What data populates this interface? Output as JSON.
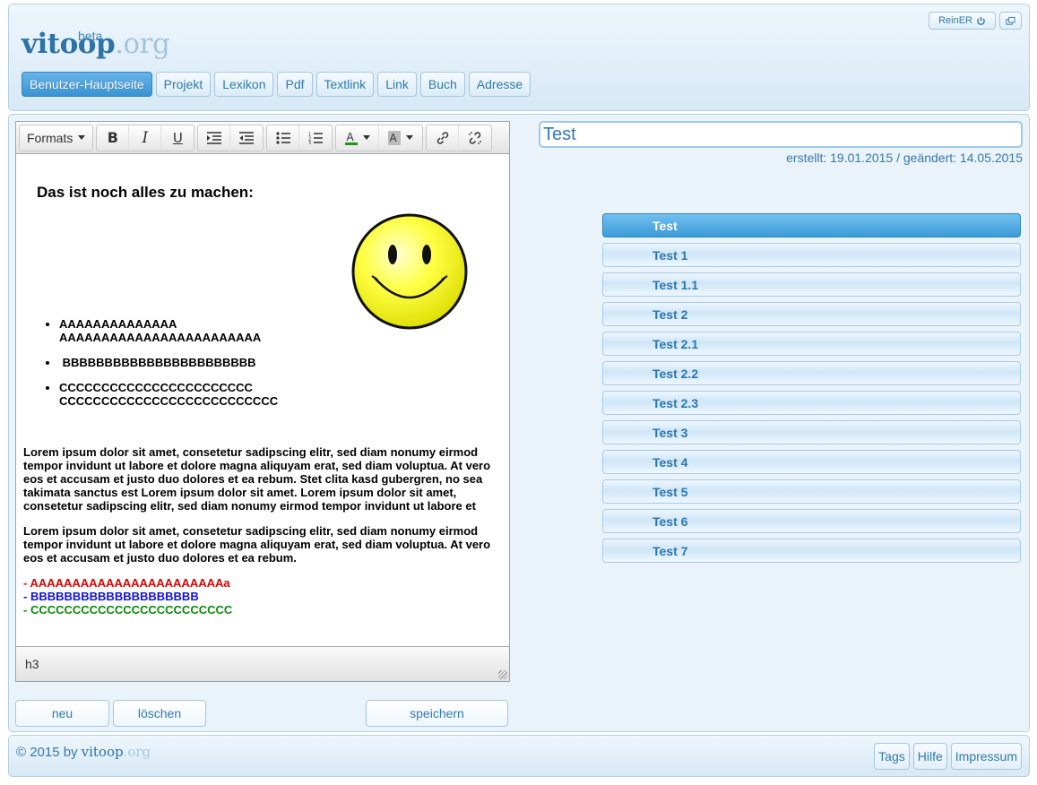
{
  "header": {
    "logo_main": "vitoop",
    "logo_dot": ".org",
    "beta": "beta",
    "user_button": "ReinER",
    "nav": [
      "Benutzer-Hauptseite",
      "Projekt",
      "Lexikon",
      "Pdf",
      "Textlink",
      "Link",
      "Buch",
      "Adresse"
    ]
  },
  "editor": {
    "formats_label": "Formats",
    "heading": "Das ist noch alles zu machen:",
    "bullets": [
      "AAAAAAAAAAAAAA AAAAAAAAAAAAAAAAAAAAAAAA",
      " BBBBBBBBBBBBBBBBBBBBBBB",
      "CCCCCCCCCCCCCCCCCCCCCCC CCCCCCCCCCCCCCCCCCCCCCCCCC"
    ],
    "para1": "Lorem ipsum dolor sit amet, consetetur sadipscing elitr, sed diam nonumy eirmod tempor invidunt ut labore et dolore magna aliquyam erat, sed diam voluptua. At vero eos et accusam et justo duo dolores et ea rebum. Stet clita kasd gubergren, no sea takimata sanctus est Lorem ipsum dolor sit amet. Lorem ipsum dolor sit amet, consetetur sadipscing elitr, sed diam nonumy eirmod tempor invidunt ut labore et",
    "para2": "Lorem ipsum dolor sit amet, consetetur sadipscing elitr, sed diam nonumy eirmod tempor invidunt ut labore et dolore magna aliquyam erat, sed diam voluptua. At vero eos et accusam et justo duo dolores et ea rebum.",
    "line_red": "- AAAAAAAAAAAAAAAAAAAAAAAa",
    "line_blue": "- BBBBBBBBBBBBBBBBBBBB",
    "line_green": "- CCCCCCCCCCCCCCCCCCCCCCCC",
    "status_path": "h3",
    "colors": {
      "red": "#e00000",
      "blue": "#1010e0",
      "green": "#0a8a0a"
    }
  },
  "actions": {
    "new": "neu",
    "delete": "löschen",
    "save": "speichern"
  },
  "right": {
    "title_value": "Test",
    "meta": "erstellt: 19.01.2015 / geändert: 14.05.2015",
    "tree": [
      "Test",
      "Test 1",
      "Test 1.1",
      "Test 2",
      "Test 2.1",
      "Test 2.2",
      "Test 2.3",
      "Test 3",
      "Test 4",
      "Test 5",
      "Test 6",
      "Test 7"
    ],
    "active_index": 0
  },
  "footer": {
    "copyright": "© 2015 by",
    "logo_main": "vitoop",
    "logo_dot": ".org",
    "links": [
      "Tags",
      "Hilfe",
      "Impressum"
    ]
  }
}
